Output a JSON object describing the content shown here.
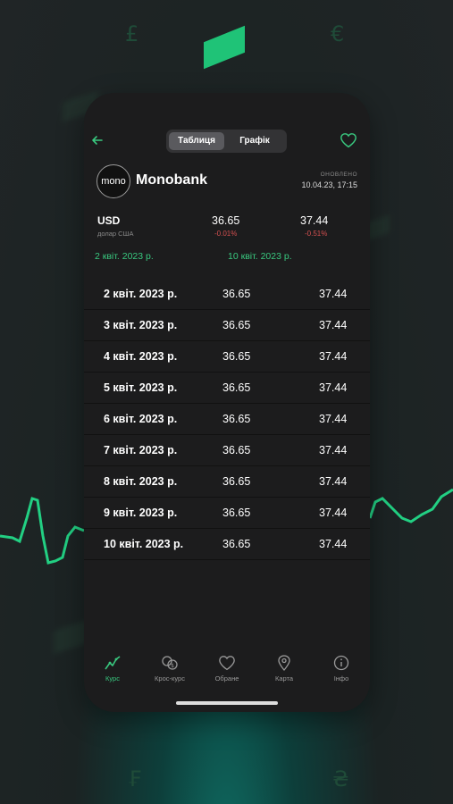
{
  "toolbar": {
    "back_icon": "arrow-left-icon",
    "segments": [
      "Таблиця",
      "Графік"
    ],
    "selected_segment": "Таблиця",
    "favorite_icon": "heart-icon"
  },
  "bank": {
    "logo_text": "mono",
    "name": "Monobank",
    "updated_label": "ОНОВЛЕНО",
    "updated_time": "10.04.23, 17:15"
  },
  "currency": {
    "code": "USD",
    "name": "долар США",
    "buy": "36.65",
    "buy_change": "-0.01%",
    "sell": "37.44",
    "sell_change": "-0.51%"
  },
  "range": {
    "from": "2 квіт. 2023 р.",
    "to": "10 квіт. 2023 р."
  },
  "rows": [
    {
      "date": "2 квіт. 2023 р.",
      "buy": "36.65",
      "sell": "37.44"
    },
    {
      "date": "3 квіт. 2023 р.",
      "buy": "36.65",
      "sell": "37.44"
    },
    {
      "date": "4 квіт. 2023 р.",
      "buy": "36.65",
      "sell": "37.44"
    },
    {
      "date": "5 квіт. 2023 р.",
      "buy": "36.65",
      "sell": "37.44"
    },
    {
      "date": "6 квіт. 2023 р.",
      "buy": "36.65",
      "sell": "37.44"
    },
    {
      "date": "7 квіт. 2023 р.",
      "buy": "36.65",
      "sell": "37.44"
    },
    {
      "date": "8 квіт. 2023 р.",
      "buy": "36.65",
      "sell": "37.44"
    },
    {
      "date": "9 квіт. 2023 р.",
      "buy": "36.65",
      "sell": "37.44"
    },
    {
      "date": "10 квіт. 2023 р.",
      "buy": "36.65",
      "sell": "37.44"
    }
  ],
  "tabs": [
    {
      "label": "Курс",
      "icon": "chart-line-icon",
      "active": true
    },
    {
      "label": "Крос-курс",
      "icon": "currency-exchange-icon",
      "active": false
    },
    {
      "label": "Обране",
      "icon": "heart-icon",
      "active": false
    },
    {
      "label": "Карта",
      "icon": "map-pin-icon",
      "active": false
    },
    {
      "label": "Інфо",
      "icon": "info-icon",
      "active": false
    }
  ],
  "background_symbols": [
    "£",
    "€",
    "₣",
    "₴"
  ],
  "colors": {
    "accent": "#39c87f",
    "negative": "#d55050",
    "screen": "#1c1c1d"
  }
}
